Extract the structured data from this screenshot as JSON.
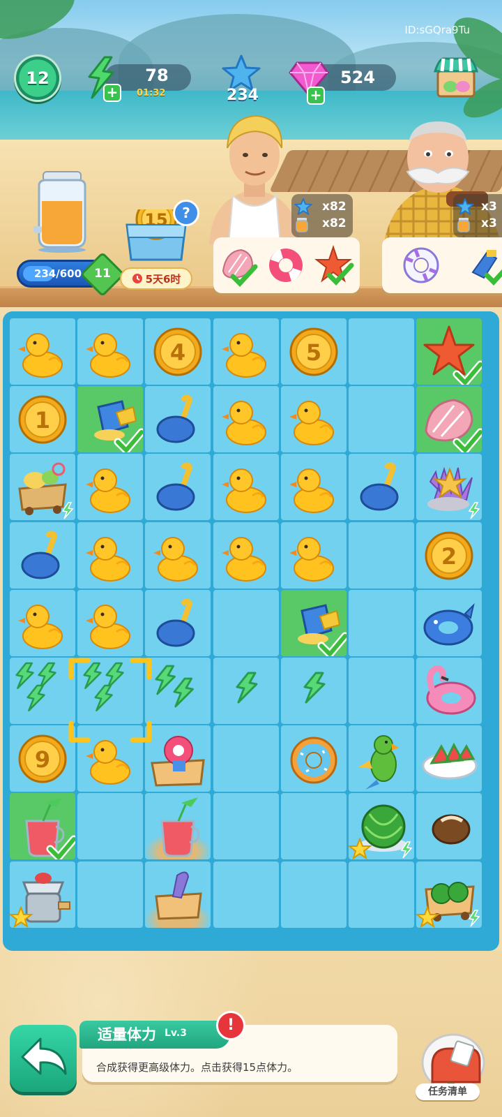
{
  "player": {
    "id": "ID:sGQra9Tu",
    "level": "12"
  },
  "resources": {
    "energy": "78",
    "energy_timer": "01:32",
    "stars": "234",
    "gems": "524"
  },
  "progress": {
    "jar_text": "234/600",
    "jar_fraction": 0.39,
    "reward_level": "11"
  },
  "event": {
    "coin_value": "15",
    "help": "?",
    "timer": "5天6时"
  },
  "orders": [
    {
      "character": "young-man",
      "star_reward": "x82",
      "juice_reward": "x82",
      "items": [
        "seashell",
        "swim-ring",
        "starfish"
      ],
      "checked": [
        true,
        false,
        true
      ]
    },
    {
      "character": "old-man",
      "star_reward": "x3",
      "juice_reward": "x3",
      "items": [
        "swim-ring-white",
        "sand-shovel"
      ],
      "checked": [
        false,
        true
      ]
    }
  ],
  "board": {
    "rows": [
      [
        "duck",
        "duck",
        "coin-4",
        "duck",
        "coin-5",
        "empty",
        "starfish*"
      ],
      [
        "coin-1",
        "bucket*",
        "shovel",
        "duck",
        "duck",
        "empty",
        "shell*"
      ],
      [
        "cart",
        "duck",
        "shovel",
        "duck",
        "duck",
        "shovel",
        "coral"
      ],
      [
        "shovel",
        "duck",
        "duck",
        "duck",
        "duck",
        "empty",
        "coin-2"
      ],
      [
        "duck",
        "duck",
        "shovel",
        "empty",
        "bucket*",
        "empty",
        "whale-ring"
      ],
      [
        "energy-3",
        "energy-3-selected",
        "energy-2",
        "energy-1",
        "energy-1",
        "empty",
        "flamingo"
      ],
      [
        "coin-9",
        "duck",
        "ring-basket",
        "empty",
        "donut",
        "parrot",
        "watermelon-plate"
      ],
      [
        "juice*",
        "empty",
        "juice-sand",
        "empty",
        "empty",
        "melon-gen",
        "coconut"
      ],
      [
        "juicer",
        "empty",
        "basket-sand",
        "empty",
        "empty",
        "empty",
        "melon-cart"
      ]
    ],
    "coin_labels": {
      "coin-1": "1",
      "coin-2": "2",
      "coin-4": "4",
      "coin-5": "5",
      "coin-9": "9"
    }
  },
  "info": {
    "title": "适量体力",
    "level": "Lv.3",
    "description": "合成获得更高级体力。点击获得15点体力。",
    "alert": "!"
  },
  "buttons": {
    "task_list": "任务清单"
  }
}
